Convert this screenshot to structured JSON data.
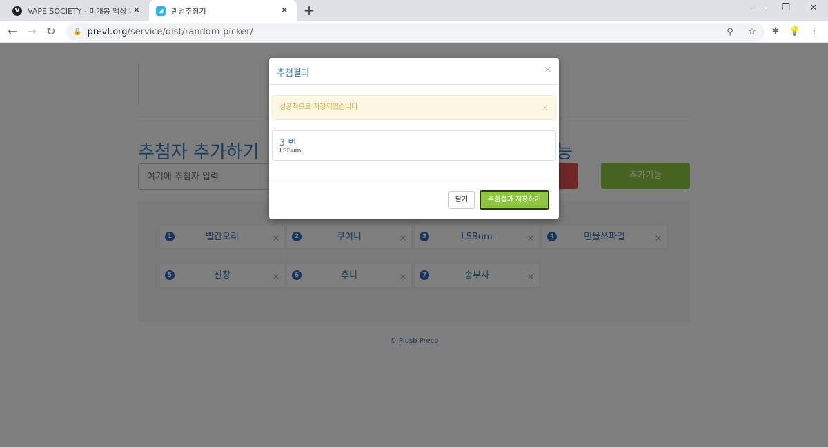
{
  "browser": {
    "tabs": [
      {
        "title": "VAPE SOCIETY - 미개봉 액상 나",
        "favicon": "V",
        "active": false
      },
      {
        "title": "랜덤추첨기",
        "favicon": "◢",
        "active": true
      }
    ],
    "new_tab": "+",
    "window_controls": {
      "minimize": "—",
      "restore": "❐",
      "close": "✕"
    },
    "url": {
      "host": "prevl.org",
      "path": "/service/dist/random-picker/"
    },
    "nav": {
      "back": "←",
      "forward": "→",
      "reload": "↻"
    },
    "icons": {
      "zoom": "⚲",
      "star": "☆",
      "extensions": "✱",
      "bulb": "💡",
      "menu": "⋮"
    }
  },
  "page": {
    "section_title": "추첨자 추가하기",
    "section_title_right_fragment": "능",
    "name_input_placeholder": "여기에 추첨자 입력",
    "add_button_label": "추가기능",
    "entries": [
      {
        "num": "1",
        "name": "빨간오리"
      },
      {
        "num": "2",
        "name": "쿠여니"
      },
      {
        "num": "3",
        "name": "LSBum"
      },
      {
        "num": "4",
        "name": "민율쓰파멀"
      },
      {
        "num": "5",
        "name": "신창"
      },
      {
        "num": "6",
        "name": "후니"
      },
      {
        "num": "7",
        "name": "송부사"
      }
    ],
    "remove_symbol": "×",
    "footer": "© Plusb Preco"
  },
  "modal": {
    "title": "추첨결과",
    "close_symbol": "×",
    "alert_text": "성공적으로 저장되었습니다",
    "alert_close": "×",
    "result_number": "3 번",
    "result_name": "LSBum",
    "close_button": "닫기",
    "save_button": "추첨결과 저장하기"
  },
  "colors": {
    "accent": "#337ab7",
    "green": "#8dc63f",
    "red": "#d9534f",
    "alert_text": "#e6a23c"
  }
}
